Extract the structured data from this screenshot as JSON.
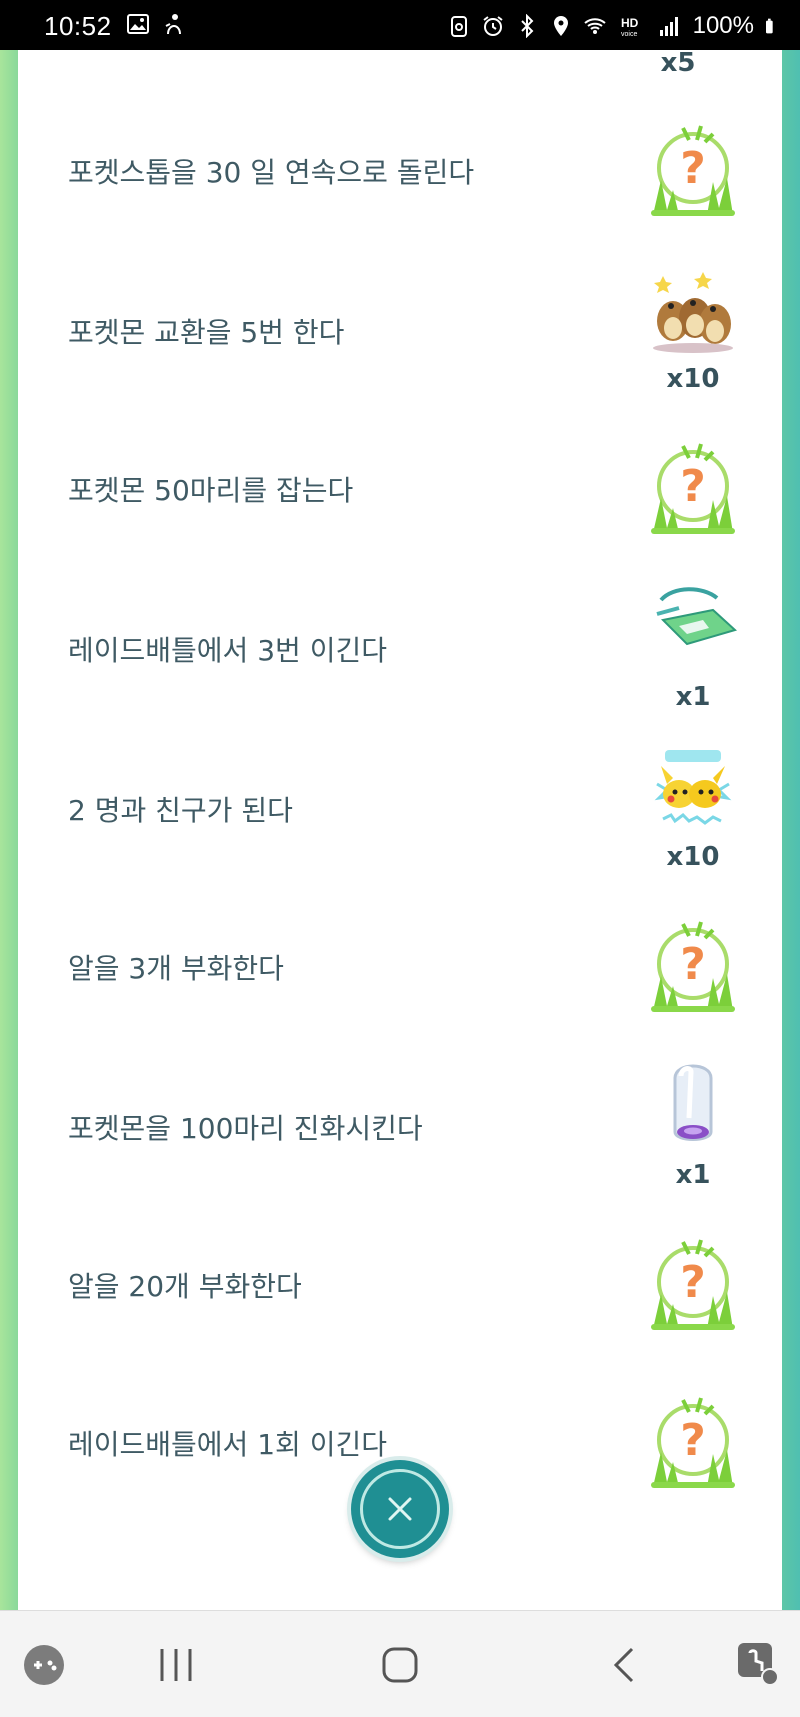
{
  "status_bar": {
    "time": "10:52",
    "battery": "100%",
    "icons_left": [
      "gallery-icon",
      "person-icon"
    ],
    "icons_right": [
      "recycle-icon",
      "alarm-icon",
      "bluetooth-icon",
      "location-icon",
      "wifi-icon",
      "hd-voice-icon",
      "signal-icon",
      "battery-icon"
    ]
  },
  "top_partial_reward": {
    "qty": "x5"
  },
  "quests": [
    {
      "label": "포켓스톱을 30 일 연속으로 돌린다",
      "reward_icon": "mystery-grass-icon",
      "qty": ""
    },
    {
      "label": "포켓몬 교환을 5번 한다",
      "reward_icon": "pidgey-group-icon",
      "qty": "x10"
    },
    {
      "label": "포켓몬 50마리를 잡는다",
      "reward_icon": "mystery-grass-icon",
      "qty": ""
    },
    {
      "label": "레이드배틀에서 3번 이긴다",
      "reward_icon": "raid-pass-icon",
      "qty": "x1"
    },
    {
      "label": "2 명과 친구가 된다",
      "reward_icon": "pikachu-group-icon",
      "qty": "x10"
    },
    {
      "label": "알을 3개 부화한다",
      "reward_icon": "mystery-grass-icon",
      "qty": ""
    },
    {
      "label": "포켓몬을 100마리 진화시킨다",
      "reward_icon": "incubator-icon",
      "qty": "x1"
    },
    {
      "label": "알을 20개 부화한다",
      "reward_icon": "mystery-grass-icon",
      "qty": ""
    },
    {
      "label": "레이드배틀에서 1회 이긴다",
      "reward_icon": "mystery-grass-icon",
      "qty": ""
    }
  ],
  "close_button": {
    "icon": "close-icon"
  },
  "nav_bar": {
    "items": [
      "game-tools-icon",
      "recent-apps-icon",
      "home-icon",
      "back-icon",
      "accessibility-icon"
    ]
  },
  "colors": {
    "accent_teal": "#1f8f93",
    "text": "#3f5a64",
    "mystery_orange": "#f08a4b",
    "grass_green": "#7ccf3a"
  }
}
